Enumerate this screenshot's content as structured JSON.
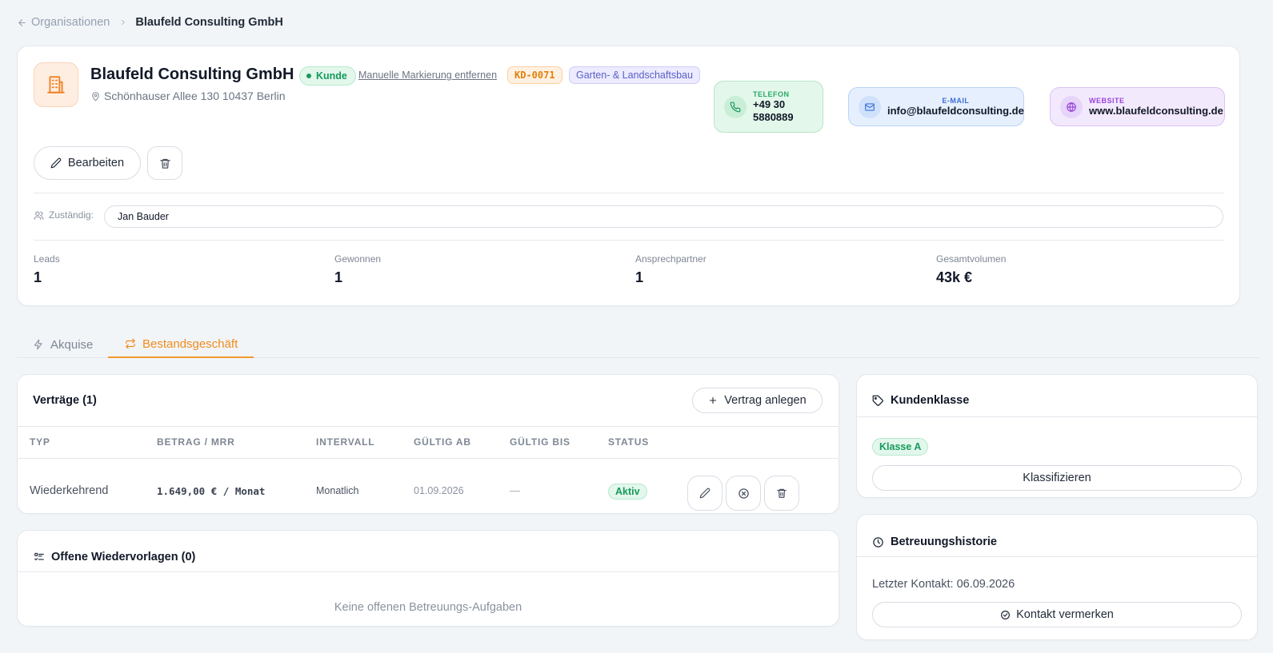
{
  "breadcrumb": {
    "back_label": "Organisationen",
    "current": "Blaufeld Consulting GmbH"
  },
  "org": {
    "name": "Blaufeld Consulting GmbH",
    "status_badge": "Kunde",
    "unmark_link": "Manuelle Markierung entfernen",
    "code": "KD-0071",
    "industry": "Garten- & Landschaftsbau",
    "address": "Schönhauser Allee 130 10437 Berlin"
  },
  "contacts": {
    "phone": {
      "label": "TELEFON",
      "value_line1": "+49 30",
      "value_line2": "5880889",
      "icon": "phone-icon"
    },
    "email": {
      "label": "E-MAIL",
      "value": "info@blaufeldconsulting.de",
      "icon": "mail-icon"
    },
    "website": {
      "label": "WEBSITE",
      "value": "www.blaufeldconsulting.de",
      "icon": "globe-icon"
    }
  },
  "actions": {
    "edit_label": "Bearbeiten"
  },
  "owner": {
    "label": "Zuständig:",
    "value": "Jan Bauder"
  },
  "stats": [
    {
      "label": "Leads",
      "value": "1"
    },
    {
      "label": "Gewonnen",
      "value": "1"
    },
    {
      "label": "Ansprechpartner",
      "value": "1"
    },
    {
      "label": "Gesamtvolumen",
      "value": "43k €"
    }
  ],
  "tabs": [
    {
      "label": "Akquise",
      "active": false
    },
    {
      "label": "Bestandsgeschäft",
      "active": true
    }
  ],
  "contracts": {
    "title": "Verträge (1)",
    "add_label": "Vertrag anlegen",
    "columns": [
      "TYP",
      "BETRAG / MRR",
      "INTERVALL",
      "GÜLTIG AB",
      "GÜLTIG BIS",
      "STATUS"
    ],
    "rows": [
      {
        "type": "Wiederkehrend",
        "amount": "1.649,00 € / Monat",
        "interval": "Monatlich",
        "valid_from": "01.09.2026",
        "valid_to": "—",
        "status": "Aktiv"
      }
    ]
  },
  "followups": {
    "title": "Offene Wiedervorlagen (0)",
    "empty": "Keine offenen Betreuungs-Aufgaben"
  },
  "customer_class": {
    "title": "Kundenklasse",
    "value": "Klasse A",
    "button": "Klassifizieren"
  },
  "history": {
    "title": "Betreuungshistorie",
    "last_contact": "Letzter Kontakt: 06.09.2026",
    "button": "Kontakt vermerken"
  },
  "colors": {
    "accent": "#f39a2c",
    "success": "#169a5c",
    "indigo": "#5b5fc7"
  }
}
